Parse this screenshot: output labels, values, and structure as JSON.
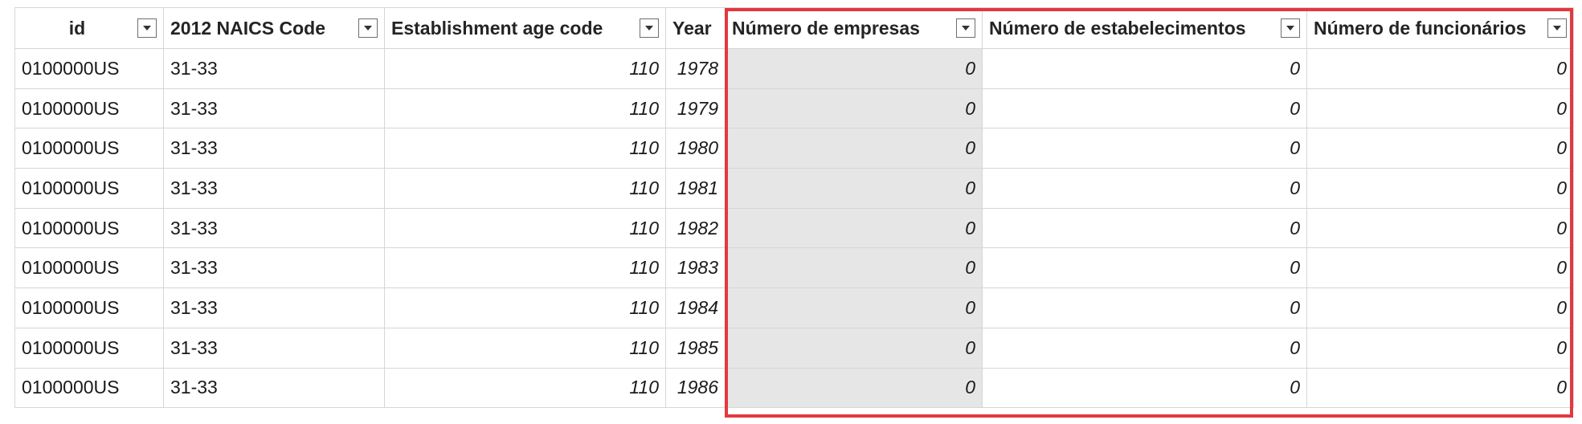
{
  "columns": [
    {
      "key": "id",
      "label": "id"
    },
    {
      "key": "naics",
      "label": "2012 NAICS Code"
    },
    {
      "key": "age",
      "label": "Establishment age code"
    },
    {
      "key": "year",
      "label": "Year"
    },
    {
      "key": "empresas",
      "label": "Número de empresas"
    },
    {
      "key": "estab",
      "label": "Número de estabelecimentos"
    },
    {
      "key": "func",
      "label": "Número de funcionários"
    }
  ],
  "rows": [
    {
      "id": "0100000US",
      "naics": "31-33",
      "age": "110",
      "year": "1978",
      "empresas": "0",
      "estab": "0",
      "func": "0"
    },
    {
      "id": "0100000US",
      "naics": "31-33",
      "age": "110",
      "year": "1979",
      "empresas": "0",
      "estab": "0",
      "func": "0"
    },
    {
      "id": "0100000US",
      "naics": "31-33",
      "age": "110",
      "year": "1980",
      "empresas": "0",
      "estab": "0",
      "func": "0"
    },
    {
      "id": "0100000US",
      "naics": "31-33",
      "age": "110",
      "year": "1981",
      "empresas": "0",
      "estab": "0",
      "func": "0"
    },
    {
      "id": "0100000US",
      "naics": "31-33",
      "age": "110",
      "year": "1982",
      "empresas": "0",
      "estab": "0",
      "func": "0"
    },
    {
      "id": "0100000US",
      "naics": "31-33",
      "age": "110",
      "year": "1983",
      "empresas": "0",
      "estab": "0",
      "func": "0"
    },
    {
      "id": "0100000US",
      "naics": "31-33",
      "age": "110",
      "year": "1984",
      "empresas": "0",
      "estab": "0",
      "func": "0"
    },
    {
      "id": "0100000US",
      "naics": "31-33",
      "age": "110",
      "year": "1985",
      "empresas": "0",
      "estab": "0",
      "func": "0"
    },
    {
      "id": "0100000US",
      "naics": "31-33",
      "age": "110",
      "year": "1986",
      "empresas": "0",
      "estab": "0",
      "func": "0"
    }
  ],
  "icons": {
    "column_filter": "chevron-down-icon"
  },
  "colors": {
    "highlight_border": "#e3383f",
    "selected_column_bg": "#e6e6e6",
    "grid_line": "#d6d6d6"
  }
}
